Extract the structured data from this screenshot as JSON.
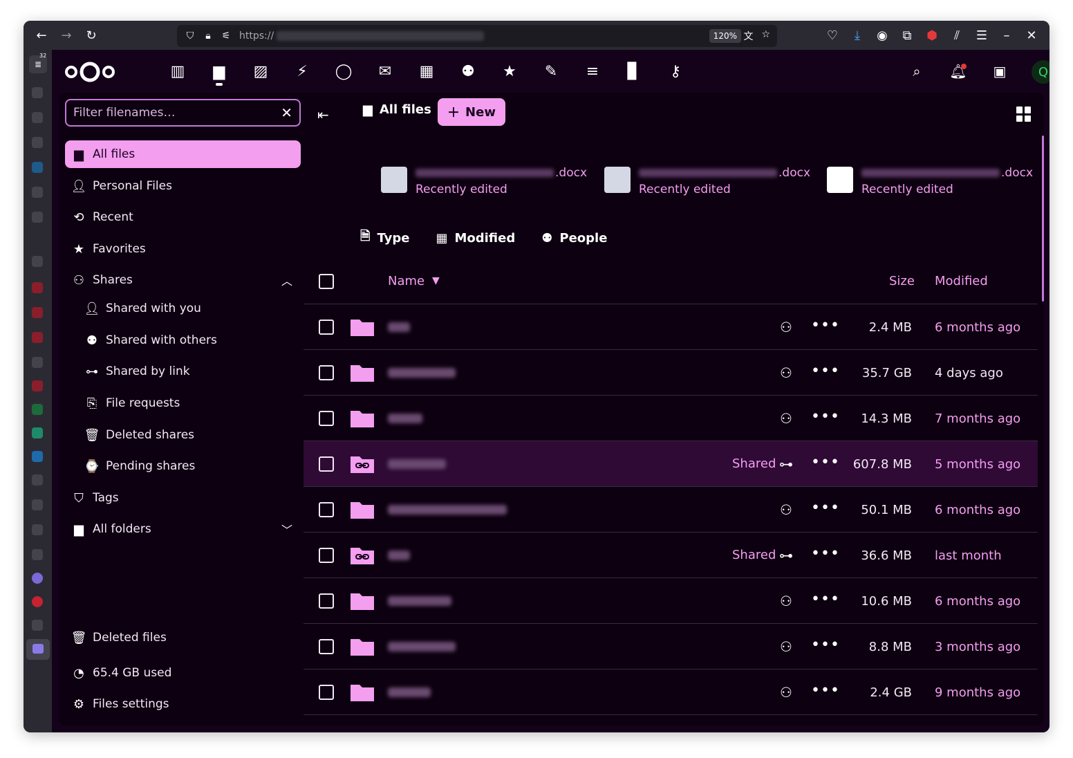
{
  "browser": {
    "url_prefix": "https://",
    "zoom": "120%",
    "tab_count": "32"
  },
  "header": {
    "apps": [
      "dashboard",
      "files",
      "photos",
      "activity",
      "talk",
      "mail",
      "calendar",
      "contacts",
      "favorites",
      "notes",
      "deck",
      "analytics",
      "passwords"
    ],
    "avatar_letter": "Q"
  },
  "sidebar": {
    "filter_placeholder": "Filter filenames…",
    "items": [
      {
        "label": "All files",
        "icon": "folder-icon",
        "active": true
      },
      {
        "label": "Personal Files",
        "icon": "person-icon"
      },
      {
        "label": "Recent",
        "icon": "history-icon"
      },
      {
        "label": "Favorites",
        "icon": "star-icon"
      },
      {
        "label": "Shares",
        "icon": "share-icon"
      }
    ],
    "shares_sub": [
      {
        "label": "Shared with you",
        "icon": "person-icon"
      },
      {
        "label": "Shared with others",
        "icon": "group-icon"
      },
      {
        "label": "Shared by link",
        "icon": "link-icon"
      },
      {
        "label": "File requests",
        "icon": "file-upload-icon"
      },
      {
        "label": "Deleted shares",
        "icon": "trash-icon"
      },
      {
        "label": "Pending shares",
        "icon": "pending-icon"
      }
    ],
    "tags": "Tags",
    "all_folders": "All folders",
    "deleted_files": "Deleted files",
    "quota": "65.4 GB used",
    "settings": "Files settings"
  },
  "main": {
    "breadcrumb": "All files",
    "new_label": "New",
    "recent_files": [
      {
        "ext": ".docx",
        "sub": "Recently edited"
      },
      {
        "ext": ".docx",
        "sub": "Recently edited"
      },
      {
        "ext": ".docx",
        "sub": "Recently edited"
      }
    ],
    "filters": [
      "Type",
      "Modified",
      "People"
    ],
    "columns": {
      "name": "Name",
      "size": "Size",
      "modified": "Modified"
    },
    "rows": [
      {
        "shared": false,
        "share_text": "",
        "size": "2.4 MB",
        "modified": "6 months ago"
      },
      {
        "shared": false,
        "share_text": "",
        "size": "35.7 GB",
        "modified": "4 days ago"
      },
      {
        "shared": false,
        "share_text": "",
        "size": "14.3 MB",
        "modified": "7 months ago"
      },
      {
        "shared": true,
        "share_text": "Shared",
        "size": "607.8 MB",
        "modified": "5 months ago"
      },
      {
        "shared": false,
        "share_text": "",
        "size": "50.1 MB",
        "modified": "6 months ago"
      },
      {
        "shared": true,
        "share_text": "Shared",
        "size": "36.6 MB",
        "modified": "last month"
      },
      {
        "shared": false,
        "share_text": "",
        "size": "10.6 MB",
        "modified": "6 months ago"
      },
      {
        "shared": false,
        "share_text": "",
        "size": "8.8 MB",
        "modified": "3 months ago"
      },
      {
        "shared": false,
        "share_text": "",
        "size": "2.4 GB",
        "modified": "9 months ago"
      }
    ]
  },
  "colors": {
    "accent": "#f49ef0",
    "background": "#0d0010",
    "highlight_row": "#2e0a35"
  }
}
